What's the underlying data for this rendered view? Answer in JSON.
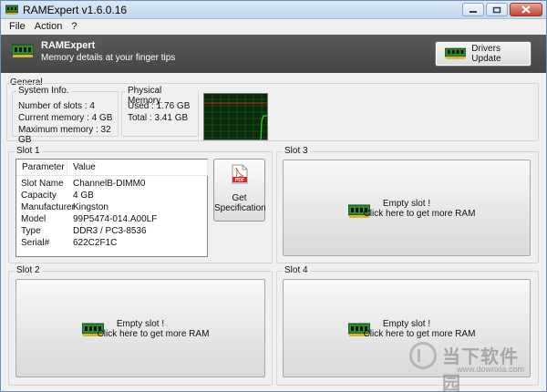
{
  "window": {
    "title": "RAMExpert v1.6.0.16",
    "controls": {
      "minimize": "minimize-icon",
      "restore": "restore-icon",
      "close": "close-icon"
    }
  },
  "menu": [
    "File",
    "Action",
    "?"
  ],
  "header": {
    "title": "RAMExpert",
    "subtitle": "Memory details at your finger tips",
    "drivers_button": "Drivers Update"
  },
  "general": {
    "label": "General",
    "system_info": {
      "title": "System Info.",
      "lines": [
        "Number of slots : 4",
        "Current memory : 4 GB",
        "Maximum memory : 32 GB"
      ]
    },
    "physical_memory": {
      "title": "Physical Memory.",
      "lines": [
        "Used : 1.76 GB",
        "Total : 3.41 GB"
      ],
      "used_fraction": 0.52
    }
  },
  "slots": {
    "slot1": {
      "title": "Slot 1",
      "columns": [
        "Parameter",
        "Value"
      ],
      "rows": [
        {
          "p": "Slot Name",
          "v": "ChannelB-DIMM0"
        },
        {
          "p": "Capacity",
          "v": "4 GB"
        },
        {
          "p": "Manufacturer",
          "v": "Kingston"
        },
        {
          "p": "Model",
          "v": "99P5474-014.A00LF"
        },
        {
          "p": "Type",
          "v": "DDR3 / PC3-8536"
        },
        {
          "p": "Serial#",
          "v": "622C2F1C"
        }
      ],
      "spec_button": {
        "line1": "Get",
        "line2": "Specification",
        "icon_text": "PDF"
      }
    },
    "slot2": {
      "title": "Slot 2",
      "line1": "Empty slot !",
      "line2": "Click here to get more RAM"
    },
    "slot3": {
      "title": "Slot 3",
      "line1": "Empty slot !",
      "line2": "Click here to get more RAM"
    },
    "slot4": {
      "title": "Slot 4",
      "line1": "Empty slot !",
      "line2": "Click here to get more RAM"
    }
  },
  "watermark": {
    "text": "当下软件园",
    "url": "www.downxia.com"
  },
  "colors": {
    "header_bg": "#4f4f4f",
    "graph_bg": "#0a2a0a",
    "graph_line": "#2ecc40",
    "graph_mark": "#cc2222"
  }
}
